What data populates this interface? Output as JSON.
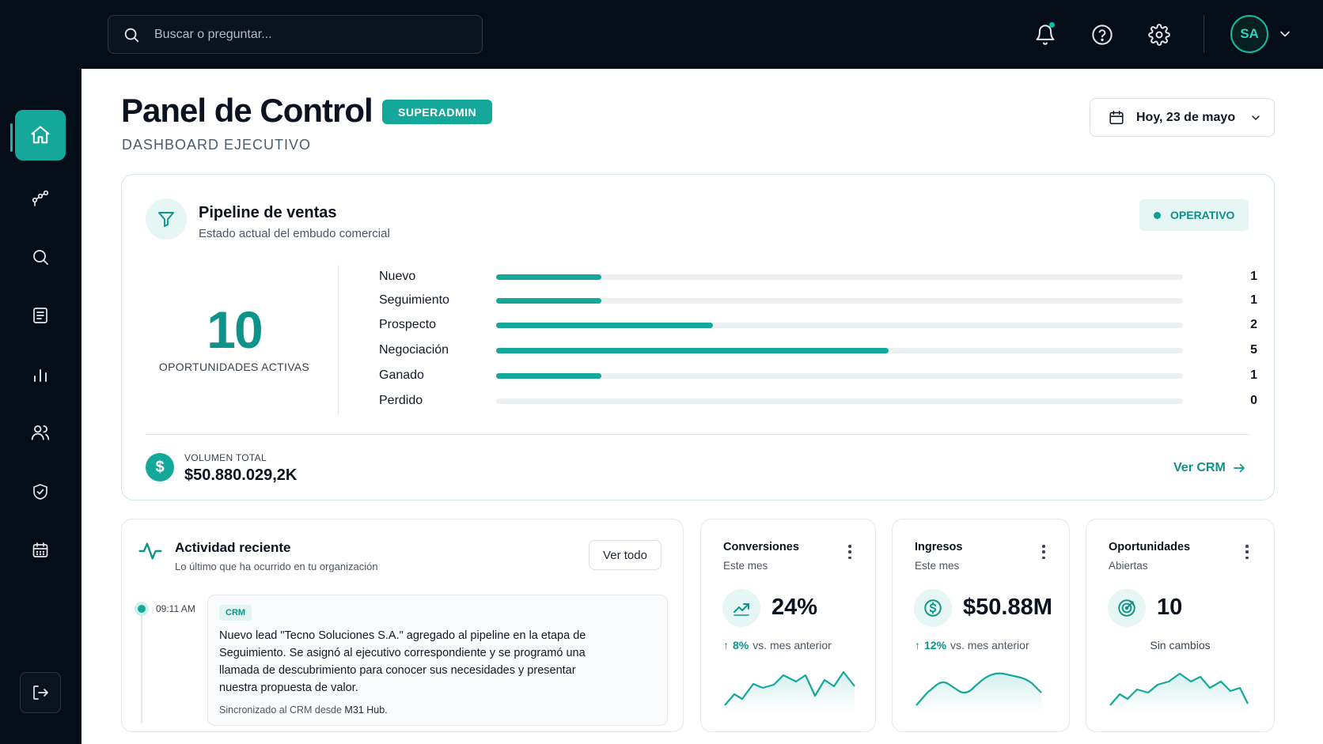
{
  "search": {
    "placeholder": "Buscar o preguntar..."
  },
  "topbar": {
    "icons": [
      "bell-icon",
      "help-icon",
      "gear-icon"
    ],
    "avatar_initials": "SA"
  },
  "sidebar": {
    "items": [
      {
        "icon": "home-icon",
        "active": true
      },
      {
        "icon": "pipeline-icon"
      },
      {
        "icon": "search-icon"
      },
      {
        "icon": "document-icon"
      },
      {
        "icon": "chart-icon"
      },
      {
        "icon": "users-icon"
      },
      {
        "icon": "shield-icon"
      },
      {
        "icon": "calendar-icon"
      }
    ],
    "logout_icon": "logout-icon"
  },
  "header": {
    "title": "Panel de Control",
    "role_badge": "SUPERADMIN",
    "subtitle": "DASHBOARD EJECUTIVO",
    "date_label": "Hoy, 23 de mayo"
  },
  "pipeline": {
    "title": "Pipeline de ventas",
    "subtitle": "Estado actual del embudo comercial",
    "status": "OPERATIVO",
    "total": "10",
    "total_label": "OPORTUNIDADES ACTIVAS",
    "stages": [
      {
        "name": "Nuevo",
        "count": "1",
        "fill": 0.153
      },
      {
        "name": "Seguimiento",
        "count": "1",
        "fill": 0.153
      },
      {
        "name": "Prospecto",
        "count": "2",
        "fill": 0.316
      },
      {
        "name": "Negociación",
        "count": "5",
        "fill": 0.572
      },
      {
        "name": "Ganado",
        "count": "1",
        "fill": 0.153
      },
      {
        "name": "Perdido",
        "count": "0",
        "fill": 0
      }
    ],
    "volume_label": "VOLUMEN TOTAL",
    "volume_value": "$50.880.029,2K",
    "link": "Ver CRM"
  },
  "activity": {
    "title": "Actividad reciente",
    "subtitle": "Lo último que ha ocurrido en tu organización",
    "see_all": "Ver todo",
    "items": [
      {
        "time": "09:11 AM",
        "tag": "CRM",
        "text": "Nuevo lead \"Tecno Soluciones S.A.\" agregado al pipeline en la etapa de Seguimiento. Se asignó al ejecutivo correspondiente y se programó una llamada de descubrimiento para conocer sus necesidades y presentar nuestra propuesta de valor.",
        "footer_prefix": "Sincronizado al CRM desde ",
        "footer_source": "M31 Hub."
      }
    ]
  },
  "kpis": [
    {
      "title": "Conversiones",
      "subtitle": "Este mes",
      "value": "24%",
      "delta": "8%",
      "delta_text": "vs. mes anterior",
      "icon": "trend-up-icon"
    },
    {
      "title": "Ingresos",
      "subtitle": "Este mes",
      "value": "$50.88M",
      "delta": "12%",
      "delta_text": "vs. mes anterior",
      "icon": "dollar-icon"
    },
    {
      "title": "Oportunidades",
      "subtitle": "Abiertas",
      "value": "10",
      "note": "Sin cambios",
      "icon": "target-icon"
    }
  ],
  "colors": {
    "accent": "#14a89a",
    "dark": "#050d18"
  }
}
